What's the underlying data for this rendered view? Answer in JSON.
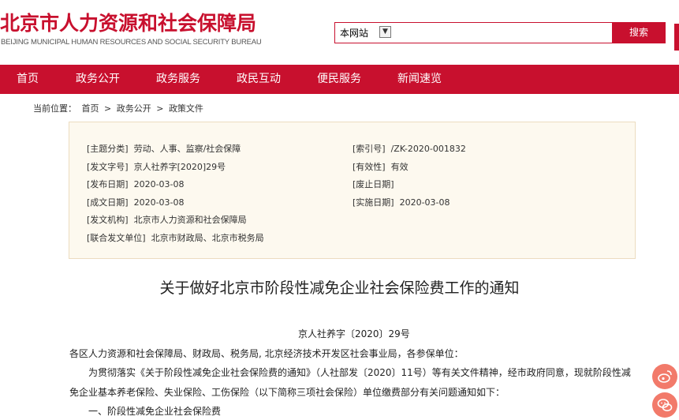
{
  "header": {
    "logo_cn": "北京市人力资源和社会保障局",
    "logo_en": "BEIJING MUNICIPAL HUMAN RESOURCES AND SOCIAL SECURITY BUREAU"
  },
  "search": {
    "scope": "本网站",
    "button": "搜索"
  },
  "nav": {
    "items": [
      "首页",
      "政务公开",
      "政务服务",
      "政民互动",
      "便民服务",
      "新闻速览"
    ]
  },
  "breadcrumb": {
    "prefix": "当前位置：",
    "items": [
      "首页",
      ">",
      "政务公开",
      ">",
      "政策文件"
    ]
  },
  "meta": {
    "left": [
      {
        "label": "[主题分类]",
        "value": "劳动、人事、监察/社会保障"
      },
      {
        "label": "[发文字号]",
        "value": "京人社养字[2020]29号"
      },
      {
        "label": "[发布日期]",
        "value": "2020-03-08"
      },
      {
        "label": "[成文日期]",
        "value": "2020-03-08"
      },
      {
        "label": "[发文机构]",
        "value": "北京市人力资源和社会保障局"
      },
      {
        "label": "[联合发文单位]",
        "value": "北京市财政局、北京市税务局"
      }
    ],
    "right": [
      {
        "label": "[索引号]",
        "value": "/ZK-2020-001832"
      },
      {
        "label": "[有效性]",
        "value": "有效"
      },
      {
        "label": "[废止日期]",
        "value": ""
      },
      {
        "label": "[实施日期]",
        "value": "2020-03-08"
      }
    ]
  },
  "article": {
    "title": "关于做好北京市阶段性减免企业社会保险费工作的通知",
    "doc_no": "京人社养字〔2020〕29号",
    "recipients": "各区人力资源和社会保障局、财政局、税务局, 北京经济技术开发区社会事业局，各参保单位：",
    "para1_line1": "为贯彻落实《关于阶段性减免企业社会保险费的通知》（人社部发〔2020〕11号）等有关文件精神，经市政府同意，现就阶段性减",
    "para1_line2": "免企业基本养老保险、失业保险、工伤保险（以下简称三项社会保险）单位缴费部分有关问题通知如下：",
    "section1": "一、阶段性减免企业社会保险费"
  },
  "icons": {
    "float_1": "weibo-icon",
    "float_2": "wechat-icon",
    "accent_color": "#c8102e"
  }
}
